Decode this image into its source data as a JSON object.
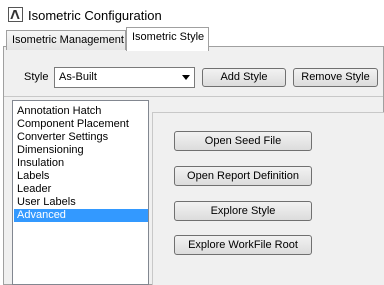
{
  "window": {
    "title": "Isometric Configuration",
    "icon": "isometric-app-icon"
  },
  "tabs": [
    {
      "label": "Isometric Management",
      "selected": false
    },
    {
      "label": "Isometric Style",
      "selected": true
    }
  ],
  "style_row": {
    "label": "Style",
    "selected_style": "As-Built",
    "add_label": "Add Style",
    "remove_label": "Remove Style"
  },
  "categories": [
    {
      "label": "Annotation Hatch",
      "selected": false
    },
    {
      "label": "Component Placement",
      "selected": false
    },
    {
      "label": "Converter Settings",
      "selected": false
    },
    {
      "label": "Dimensioning",
      "selected": false
    },
    {
      "label": "Insulation",
      "selected": false
    },
    {
      "label": "Labels",
      "selected": false
    },
    {
      "label": "Leader",
      "selected": false
    },
    {
      "label": "User Labels",
      "selected": false
    },
    {
      "label": "Advanced",
      "selected": true
    }
  ],
  "advanced": {
    "open_seed_file": "Open Seed File",
    "open_report_definition": "Open Report Definition",
    "explore_style": "Explore Style",
    "explore_workfile_root": "Explore WorkFile Root"
  }
}
